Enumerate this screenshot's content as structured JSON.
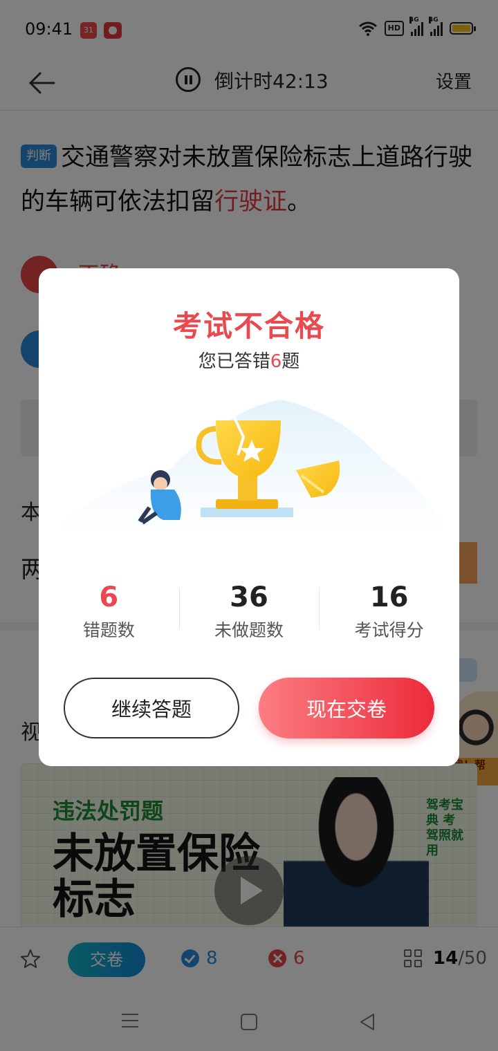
{
  "status_bar": {
    "time": "09:41",
    "app_badge": "31",
    "network_label_1": "4G",
    "network_label_2": "4G",
    "hd_label": "HD",
    "battery_color": "#f7c51b"
  },
  "header": {
    "countdown": "倒计时42:13",
    "settings_label": "设置"
  },
  "question": {
    "type_tag": "判断",
    "text_before": "交通警察对未放置保险标志上道路行驶的车辆可依法扣留",
    "text_highlight": "行驶证",
    "text_after": "。"
  },
  "options": {
    "wrong_label": "正确"
  },
  "background": {
    "text1": "本",
    "text2": "两",
    "text3": "视"
  },
  "teacher_tag": "点我！帮你讲",
  "video": {
    "category": "违法处罚题",
    "title": "未放置保险标志",
    "side_text": "驾考宝典 考驾照就用"
  },
  "dialog": {
    "title": "考试不合格",
    "subtitle_before": "您已答错",
    "subtitle_num": "6",
    "subtitle_after": "题",
    "stats": [
      {
        "value": "6",
        "label": "错题数"
      },
      {
        "value": "36",
        "label": "未做题数"
      },
      {
        "value": "16",
        "label": "考试得分"
      }
    ],
    "continue_label": "继续答题",
    "submit_label": "现在交卷"
  },
  "bottom_bar": {
    "submit_label": "交卷",
    "right_count": "8",
    "wrong_count": "6",
    "current_page": "14",
    "total_pages": "/50"
  },
  "colors": {
    "accent_red": "#e84a4f",
    "accent_blue": "#2a8bd8"
  }
}
